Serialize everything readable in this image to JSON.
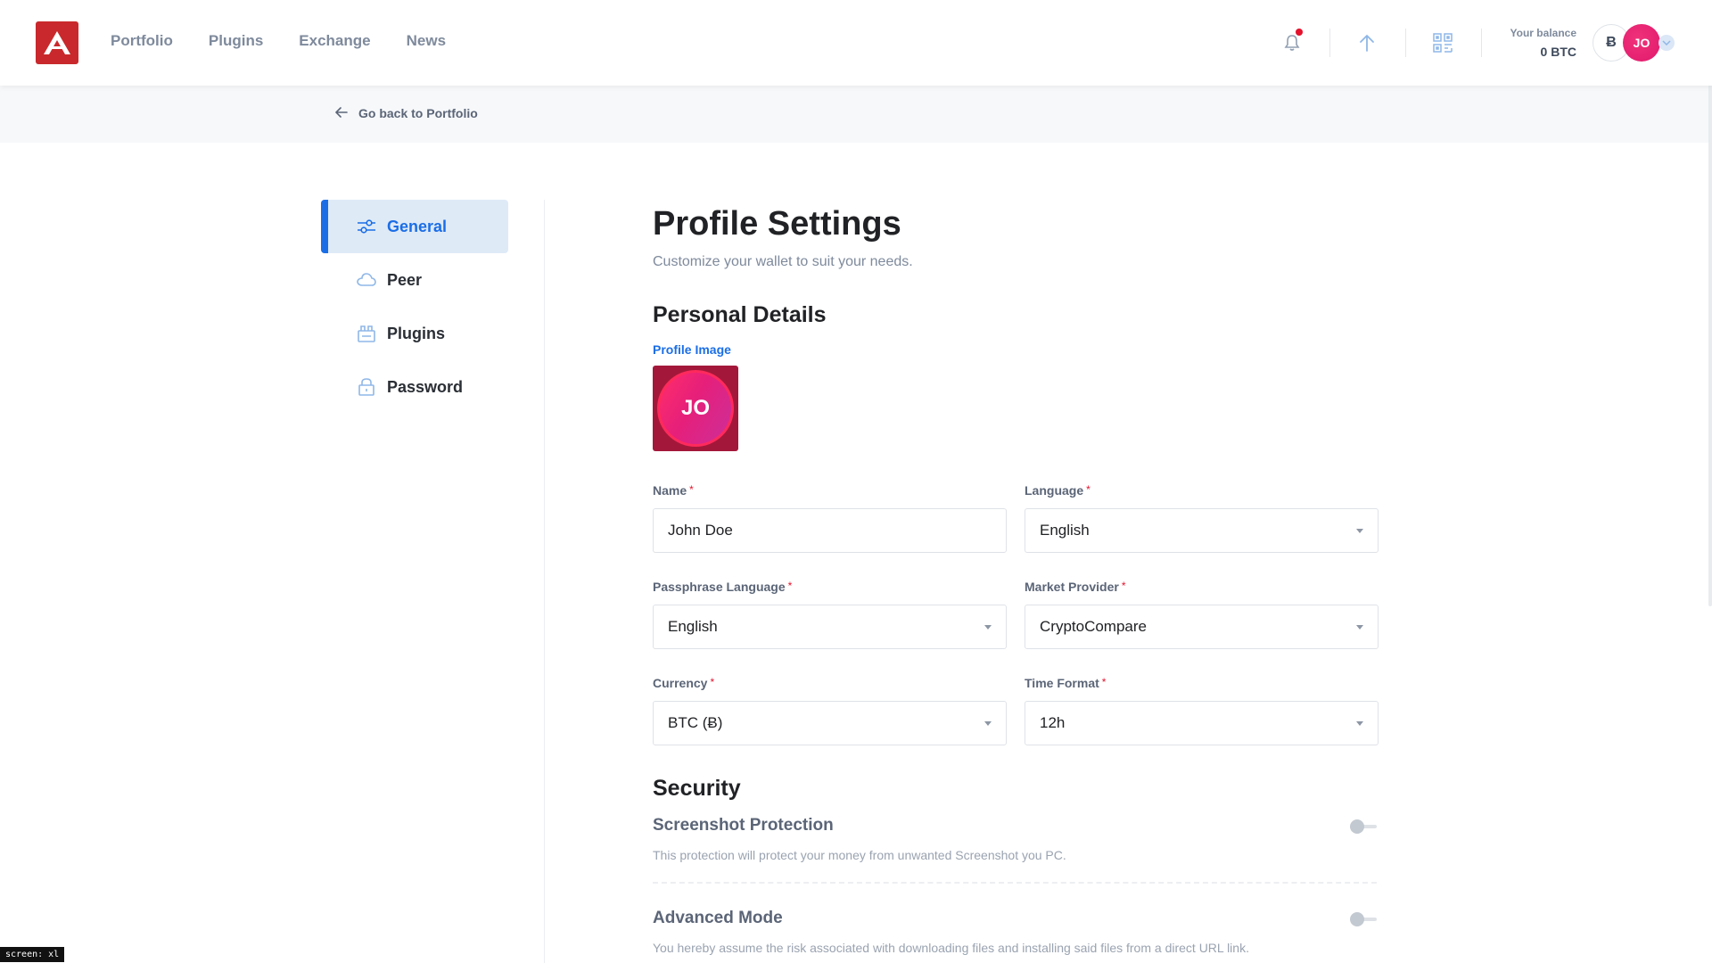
{
  "header": {
    "nav": [
      "Portfolio",
      "Plugins",
      "Exchange",
      "News"
    ],
    "balance_label": "Your balance",
    "balance_value": "0 BTC",
    "currency_symbol": "Ƀ",
    "avatar_initials": "JO",
    "icons": [
      "ark-logo-icon",
      "bell-icon",
      "send-arrow-up-icon",
      "qr-code-icon",
      "chevron-down-icon"
    ]
  },
  "back_link": "Go back to Portfolio",
  "sidebar": {
    "items": [
      {
        "label": "General",
        "icon": "sliders-icon",
        "active": true
      },
      {
        "label": "Peer",
        "icon": "cloud-icon",
        "active": false
      },
      {
        "label": "Plugins",
        "icon": "plugin-box-icon",
        "active": false
      },
      {
        "label": "Password",
        "icon": "lock-icon",
        "active": false
      }
    ]
  },
  "main": {
    "title": "Profile Settings",
    "subtitle": "Customize your wallet to suit your needs.",
    "personal_title": "Personal Details",
    "profile_image_label": "Profile Image",
    "profile_initials": "JO",
    "fields": {
      "name": {
        "label": "Name",
        "value": "John Doe"
      },
      "language": {
        "label": "Language",
        "value": "English"
      },
      "passphrase_language": {
        "label": "Passphrase Language",
        "value": "English"
      },
      "market_provider": {
        "label": "Market Provider",
        "value": "CryptoCompare"
      },
      "currency": {
        "label": "Currency",
        "value": "BTC (Ƀ)"
      },
      "time_format": {
        "label": "Time Format",
        "value": "12h"
      }
    },
    "security_title": "Security",
    "security": [
      {
        "title": "Screenshot Protection",
        "description": "This protection will protect your money from unwanted Screenshot you PC.",
        "enabled": false
      },
      {
        "title": "Advanced Mode",
        "description": "You hereby assume the risk associated with downloading files and installing said files from a direct URL link.",
        "enabled": false
      }
    ]
  },
  "footer_tag": "screen: xl",
  "colors": {
    "brand": "#c9292c",
    "accent": "#1b6ee6",
    "avatar": "#e0186c",
    "required": "#e4122c"
  }
}
